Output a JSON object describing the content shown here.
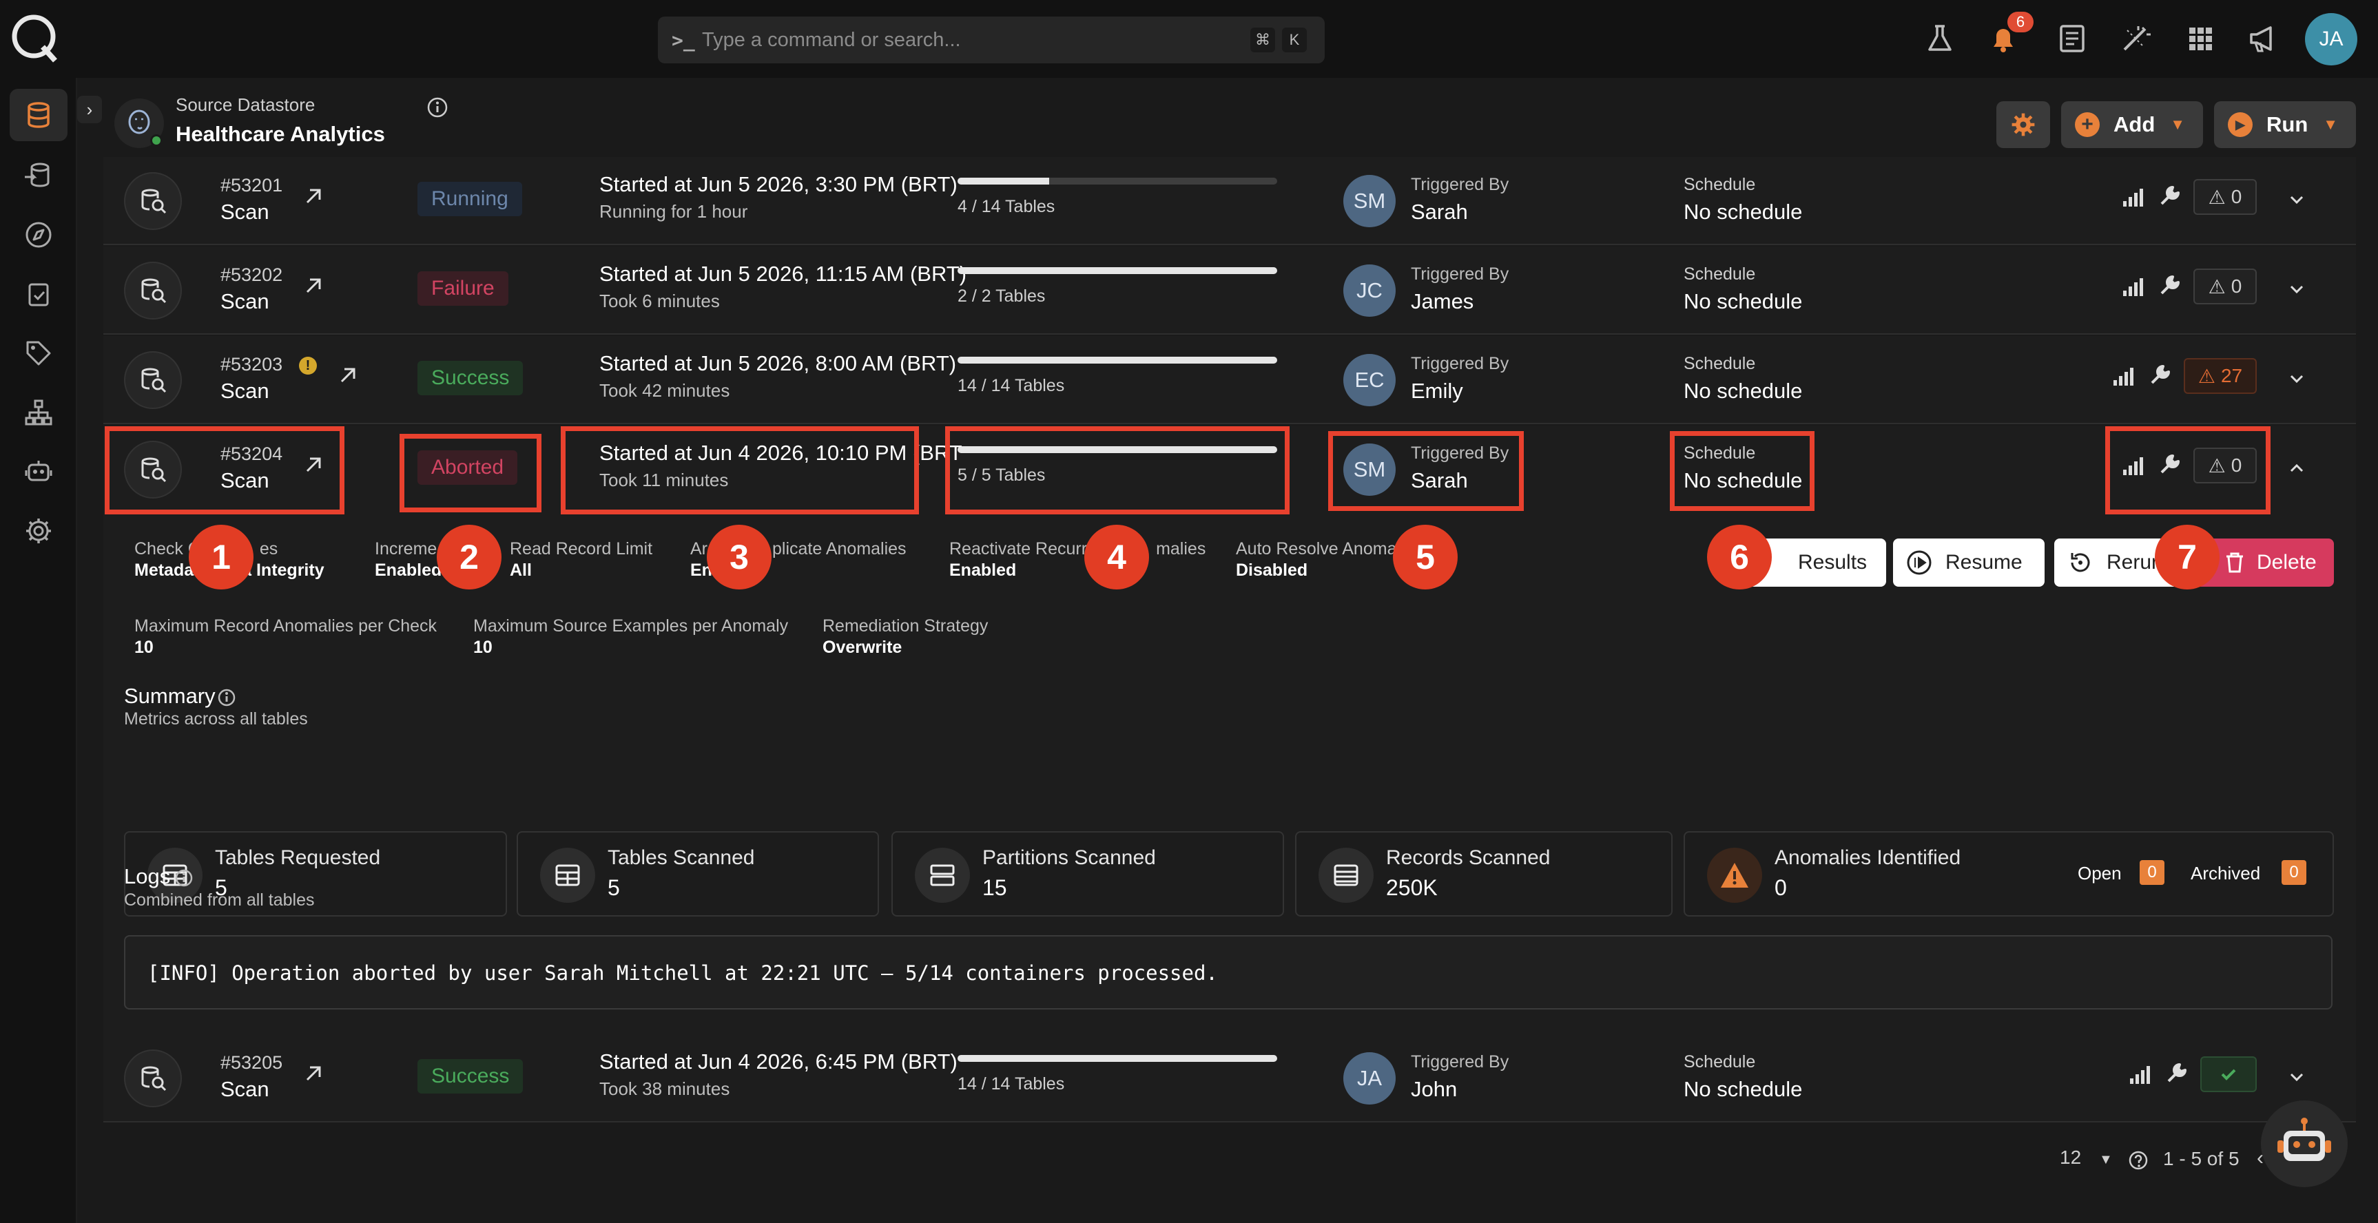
{
  "search": {
    "placeholder": "Type a command or search...",
    "k1": "⌘",
    "k2": "K"
  },
  "notifications": {
    "count": "6"
  },
  "user": {
    "initials": "JA"
  },
  "datastore": {
    "label": "Source Datastore",
    "name": "Healthcare Analytics"
  },
  "header_buttons": {
    "add": "Add",
    "run": "Run"
  },
  "rows": [
    {
      "id": "#53201",
      "type": "Scan",
      "status": "Running",
      "started": "Started at Jun 5 2026, 3:30 PM (BRT)",
      "took": "Running for 1 hour",
      "progress": 0.286,
      "progress_text": "4 / 14 Tables",
      "initials": "SM",
      "trig_label": "Triggered By",
      "trig_name": "Sarah",
      "sch_label": "Schedule",
      "sch_value": "No schedule",
      "anomalies": "0"
    },
    {
      "id": "#53202",
      "type": "Scan",
      "status": "Failure",
      "started": "Started at Jun 5 2026, 11:15 AM (BRT)",
      "took": "Took 6 minutes",
      "progress": 1.0,
      "progress_text": "2 / 2 Tables",
      "initials": "JC",
      "trig_label": "Triggered By",
      "trig_name": "James",
      "sch_label": "Schedule",
      "sch_value": "No schedule",
      "anomalies": "0"
    },
    {
      "id": "#53203",
      "type": "Scan",
      "status": "Success",
      "started": "Started at Jun 5 2026, 8:00 AM (BRT)",
      "took": "Took 42 minutes",
      "progress": 1.0,
      "progress_text": "14 / 14 Tables",
      "initials": "EC",
      "trig_label": "Triggered By",
      "trig_name": "Emily",
      "sch_label": "Schedule",
      "sch_value": "No schedule",
      "anomalies": "27"
    },
    {
      "id": "#53204",
      "type": "Scan",
      "status": "Aborted",
      "started": "Started at Jun 4 2026, 10:10 PM (BRT",
      "took": "Took 11 minutes",
      "progress": 1.0,
      "progress_text": "5 / 5 Tables",
      "initials": "SM",
      "trig_label": "Triggered By",
      "trig_name": "Sarah",
      "sch_label": "Schedule",
      "sch_value": "No schedule",
      "anomalies": "0"
    },
    {
      "id": "#53205",
      "type": "Scan",
      "status": "Success",
      "started": "Started at Jun 4 2026, 6:45 PM (BRT)",
      "took": "Took 38 minutes",
      "progress": 1.0,
      "progress_text": "14 / 14 Tables",
      "initials": "JA",
      "trig_label": "Triggered By",
      "trig_name": "John",
      "sch_label": "Schedule",
      "sch_value": "No schedule",
      "anomalies": ""
    }
  ],
  "details": {
    "check_label": "Check C",
    "check_label_tail": "es",
    "check_value": "Metada",
    "check_value_tail": "a Integrity",
    "incr_label": "Increme",
    "incr_value": "Enabled",
    "read_label": "Read Record Limit",
    "read_value": "All",
    "dup_label_a": "Ar",
    "dup_label_b": "plicate Anomalies",
    "dup_value": "En",
    "reactivate_label_a": "Reactivate Recurr",
    "reactivate_label_b": "malies",
    "reactivate_value": "Enabled",
    "auto_label": "Auto Resolve Anomal",
    "auto_value": "Disabled",
    "max_rec_label": "Maximum Record Anomalies per Check",
    "max_rec_value": "10",
    "max_src_label": "Maximum Source Examples per Anomaly",
    "max_src_value": "10",
    "remed_label": "Remediation Strategy",
    "remed_value": "Overwrite"
  },
  "actions": {
    "results": "Results",
    "resume": "Resume",
    "rerun": "Rerun",
    "delete": "Delete"
  },
  "summary": {
    "title": "Summary",
    "subtitle": "Metrics across all tables",
    "cards": [
      {
        "title": "Tables Requested",
        "value": "5"
      },
      {
        "title": "Tables Scanned",
        "value": "5"
      },
      {
        "title": "Partitions Scanned",
        "value": "15"
      },
      {
        "title": "Records Scanned",
        "value": "250K"
      },
      {
        "title": "Anomalies Identified",
        "value": "0"
      }
    ],
    "open_label": "Open",
    "open_count": "0",
    "archived_label": "Archived",
    "archived_count": "0"
  },
  "logs": {
    "title": "Logs",
    "subtitle": "Combined from all tables",
    "text": "[INFO] Operation aborted by user Sarah Mitchell at 22:21 UTC — 5/14 containers processed."
  },
  "annotations": [
    "1",
    "2",
    "3",
    "4",
    "5",
    "6",
    "7"
  ],
  "pagination": {
    "per_page": "12",
    "range": "1 - 5 of 5"
  },
  "colors": {
    "accent": "#e8412e",
    "aborted": "#d24462",
    "success": "#4aab5c",
    "warning": "#e56d34",
    "delete": "#d63a5e"
  }
}
